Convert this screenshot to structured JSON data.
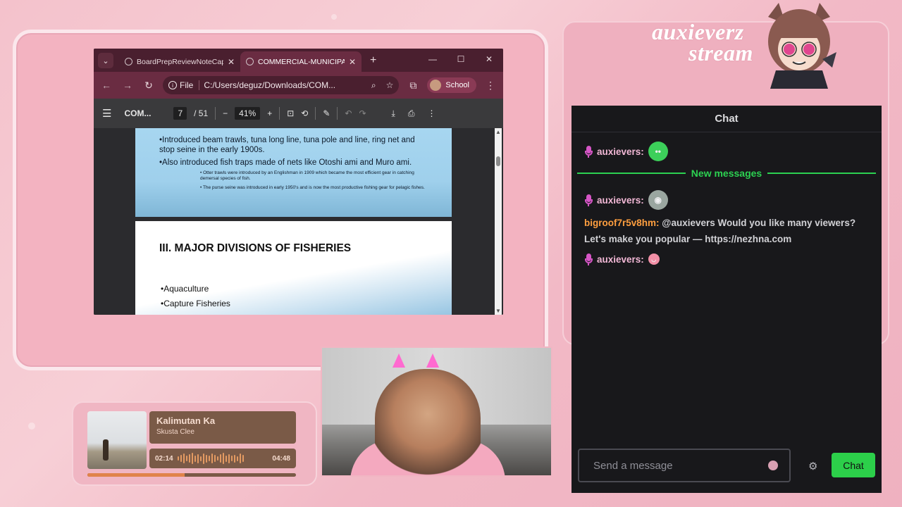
{
  "browser": {
    "tabs": [
      {
        "label": "BoardPrepReviewNoteCap",
        "active": false
      },
      {
        "label": "COMMERCIAL-MUNICIPAL",
        "active": true
      }
    ],
    "address": {
      "chip_label": "File",
      "url": "C:/Users/deguz/Downloads/COM..."
    },
    "profile_label": "School"
  },
  "pdf_toolbar": {
    "doc_title": "COM...",
    "page_current": "7",
    "page_total": "/ 51",
    "zoom": "41%"
  },
  "slide1": {
    "bullet1": "•Introduced beam trawls, tuna long line, tuna pole and line, ring net and stop seine in the early 1900s.",
    "bullet2": "•Also introduced fish traps made of nets like Otoshi ami and Muro ami.",
    "sub1": "• Otter trawls were introduced by an Englishman in 1909 which became the most efficient gear in catching demersal species of fish.",
    "sub2": "• The purse seine was introduced in early 1950's and is now the most productive fishing gear for pelagic fishes."
  },
  "slide2": {
    "heading": "III. MAJOR DIVISIONS OF FISHERIES",
    "item1": "•Aquaculture",
    "item2": "•Capture Fisheries"
  },
  "music": {
    "title": "Kalimutan Ka",
    "artist": "Skusta Clee",
    "elapsed": "02:14",
    "duration": "04:48",
    "progress_fraction": 0.465
  },
  "brand": {
    "line1": "auxieverz",
    "line2": "stream"
  },
  "chat": {
    "header": "Chat",
    "new_messages_label": "New messages",
    "messages": [
      {
        "user": "auxievers:",
        "emote_color": "#3ccf5a"
      },
      {
        "user": "auxievers:",
        "emote_color": "#9aa6a0"
      },
      {
        "user": "bigroof7r5v8hm:",
        "text": "@auxievers Would you like many viewers? Let's make you popular — https://nezhna.com"
      },
      {
        "user": "auxievers:",
        "emote_color": "#f28fa6"
      }
    ],
    "input_placeholder": "Send a message",
    "send_label": "Chat"
  },
  "icons": {
    "tab_menu": "chevron-down-icon",
    "globe": "globe-icon",
    "close": "close-icon",
    "new_tab": "plus-icon",
    "back": "back-arrow-icon",
    "forward": "forward-arrow-icon",
    "reload": "reload-icon",
    "search": "search-icon",
    "star": "star-icon",
    "extensions": "puzzle-icon",
    "kebab": "kebab-menu-icon",
    "download": "download-icon",
    "print": "print-icon",
    "settings": "gear-icon",
    "mic": "microphone-icon"
  },
  "colors": {
    "background_pink": "#f4c2cc",
    "browser_frame": "#6a2c42",
    "chat_bg": "#18181b",
    "new_messages": "#2cd151",
    "chat_button": "#2ccf4a",
    "spam_user": "#ff9f3f"
  }
}
